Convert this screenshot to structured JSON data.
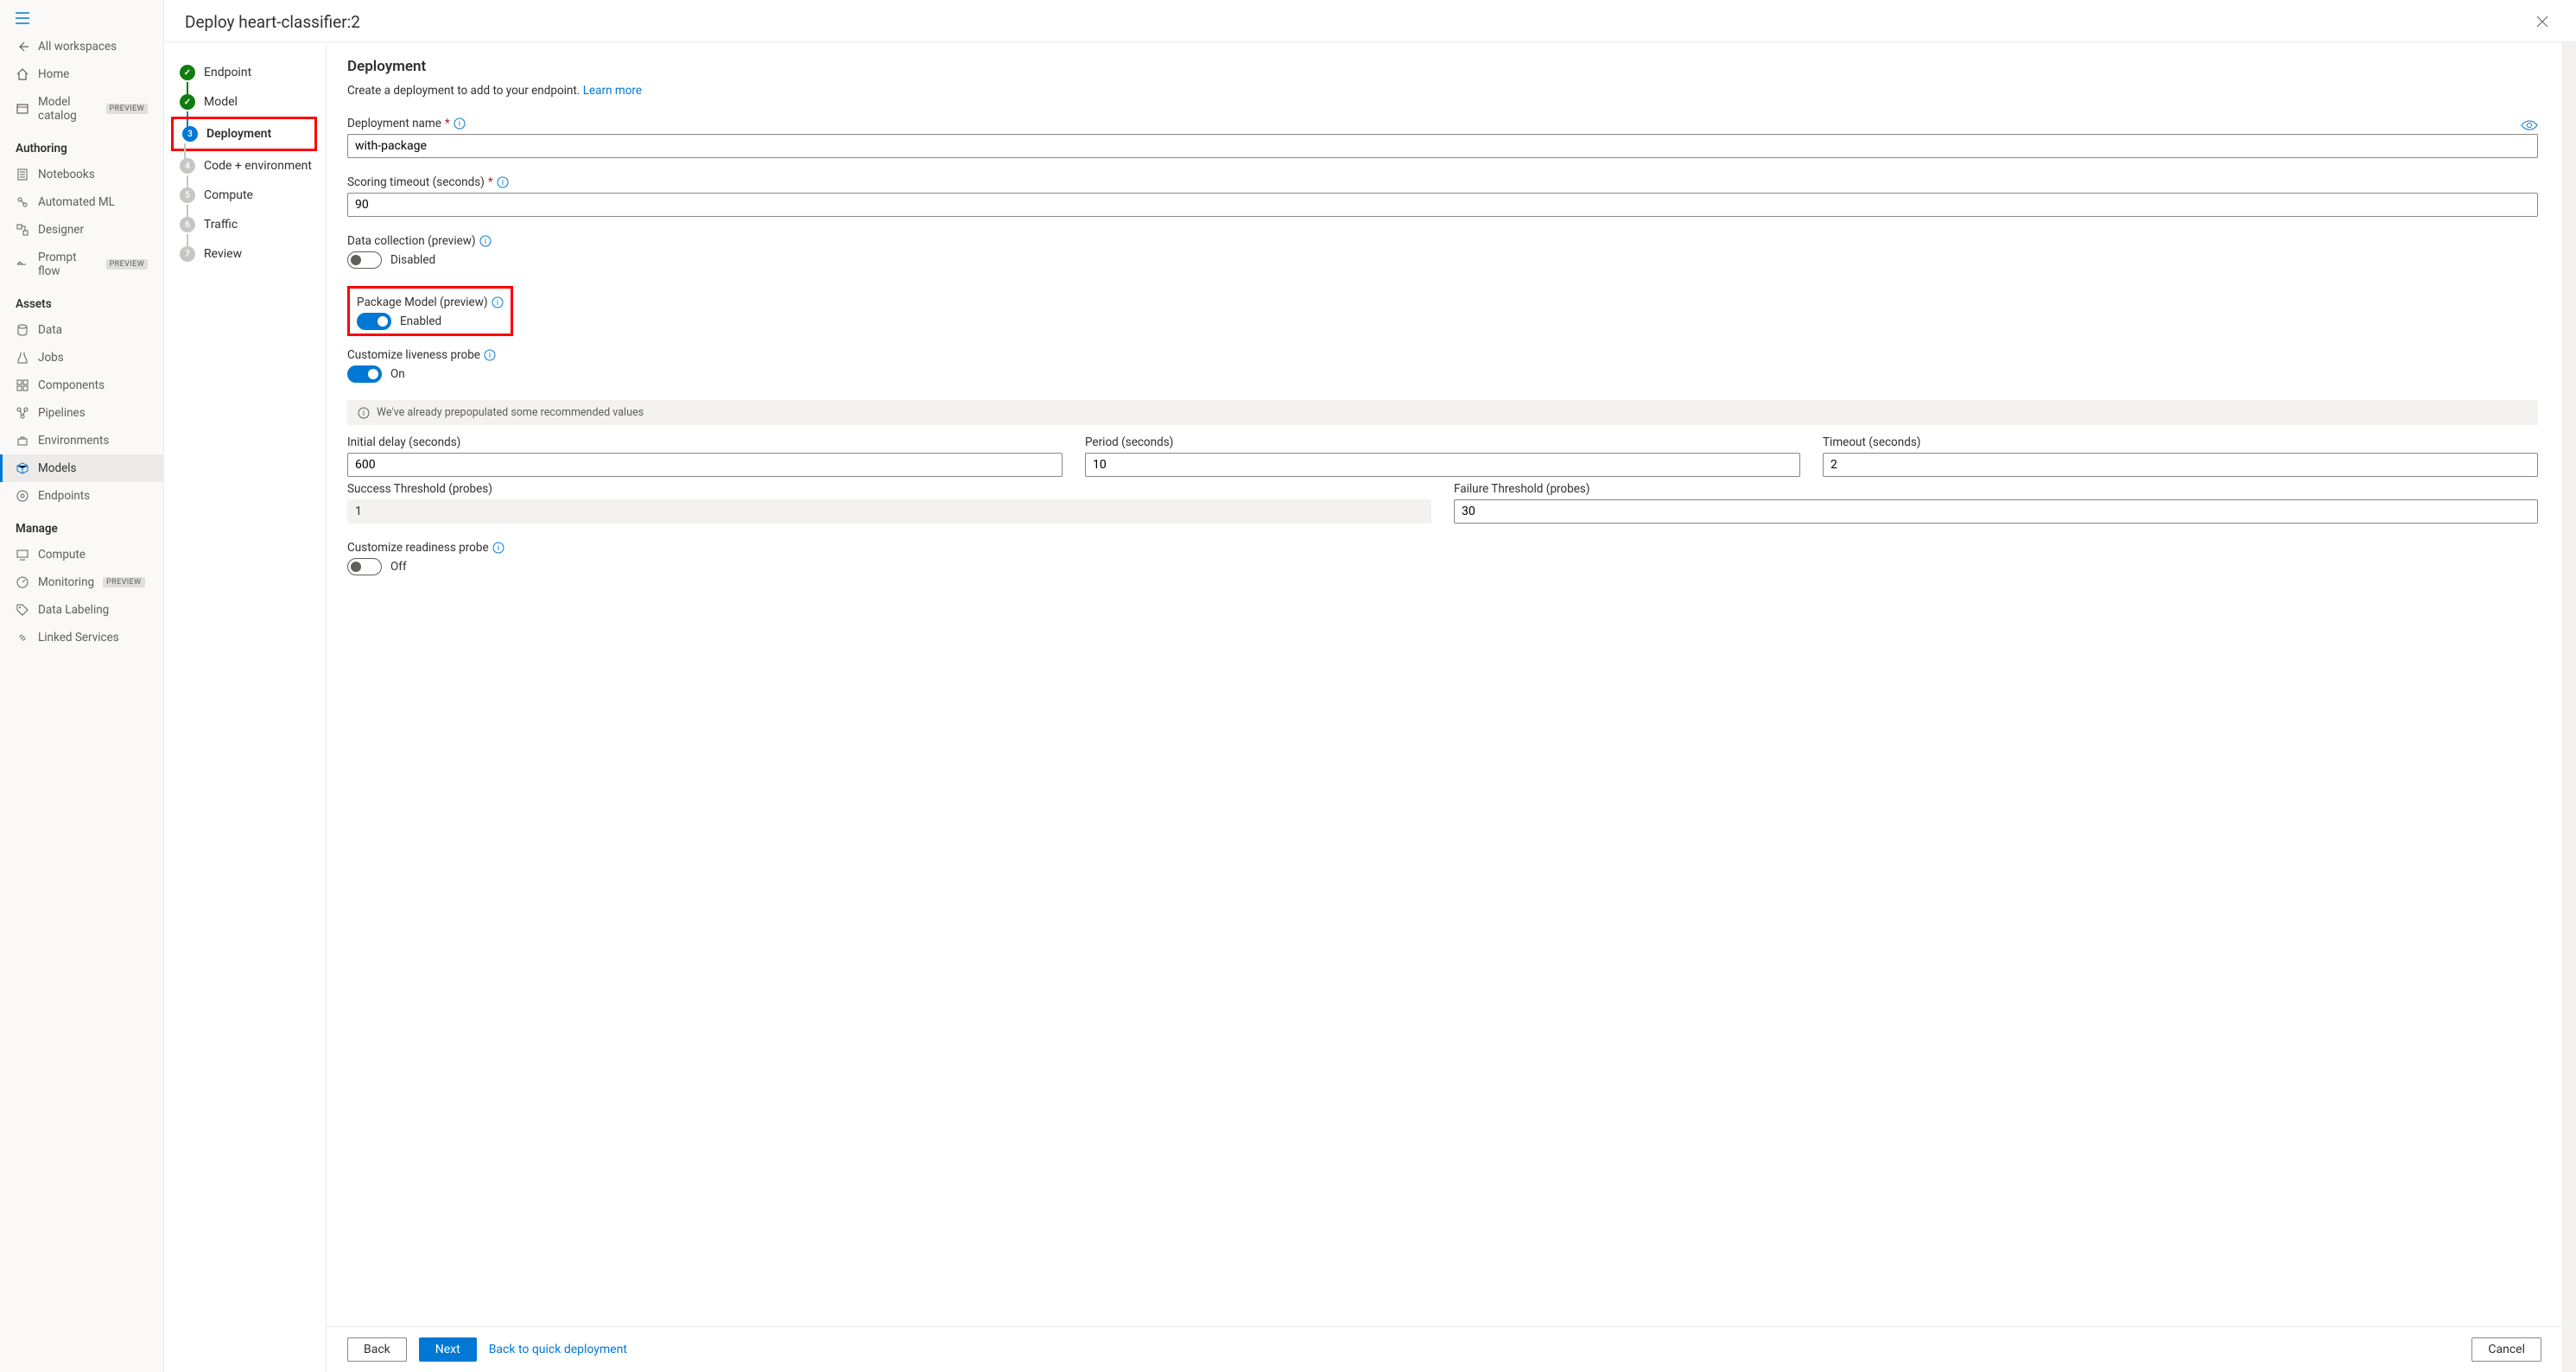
{
  "sidebar": {
    "all_workspaces": "All workspaces",
    "home": "Home",
    "model_catalog": "Model catalog",
    "authoring_heading": "Authoring",
    "notebooks": "Notebooks",
    "automated_ml": "Automated ML",
    "designer": "Designer",
    "prompt_flow": "Prompt flow",
    "assets_heading": "Assets",
    "data": "Data",
    "jobs": "Jobs",
    "components": "Components",
    "pipelines": "Pipelines",
    "environments": "Environments",
    "models": "Models",
    "endpoints": "Endpoints",
    "manage_heading": "Manage",
    "compute": "Compute",
    "monitoring": "Monitoring",
    "data_labeling": "Data Labeling",
    "linked_services": "Linked Services",
    "preview_badge": "PREVIEW"
  },
  "dialog": {
    "title": "Deploy heart-classifier:2"
  },
  "wizard": {
    "steps": [
      {
        "num": "✓",
        "label": "Endpoint",
        "state": "done"
      },
      {
        "num": "✓",
        "label": "Model",
        "state": "done"
      },
      {
        "num": "3",
        "label": "Deployment",
        "state": "current"
      },
      {
        "num": "4",
        "label": "Code + environment",
        "state": "pending"
      },
      {
        "num": "5",
        "label": "Compute",
        "state": "pending"
      },
      {
        "num": "6",
        "label": "Traffic",
        "state": "pending"
      },
      {
        "num": "7",
        "label": "Review",
        "state": "pending"
      }
    ]
  },
  "form": {
    "title": "Deployment",
    "description": "Create a deployment to add to your endpoint.",
    "learn_more": "Learn more",
    "name_label": "Deployment name",
    "name_value": "with-package",
    "timeout_label": "Scoring timeout (seconds)",
    "timeout_value": "90",
    "data_collection_label": "Data collection (preview)",
    "data_collection_state": "Disabled",
    "package_model_label": "Package Model (preview)",
    "package_model_state": "Enabled",
    "liveness_label": "Customize liveness probe",
    "liveness_state": "On",
    "prepopulated_msg": "We've already prepopulated some recommended values",
    "initial_delay_label": "Initial delay (seconds)",
    "initial_delay_value": "600",
    "period_label": "Period (seconds)",
    "period_value": "10",
    "probe_timeout_label": "Timeout (seconds)",
    "probe_timeout_value": "2",
    "success_threshold_label": "Success Threshold (probes)",
    "success_threshold_value": "1",
    "failure_threshold_label": "Failure Threshold (probes)",
    "failure_threshold_value": "30",
    "readiness_label": "Customize readiness probe",
    "readiness_state": "Off"
  },
  "footer": {
    "back": "Back",
    "next": "Next",
    "back_to_quick": "Back to quick deployment",
    "cancel": "Cancel"
  }
}
